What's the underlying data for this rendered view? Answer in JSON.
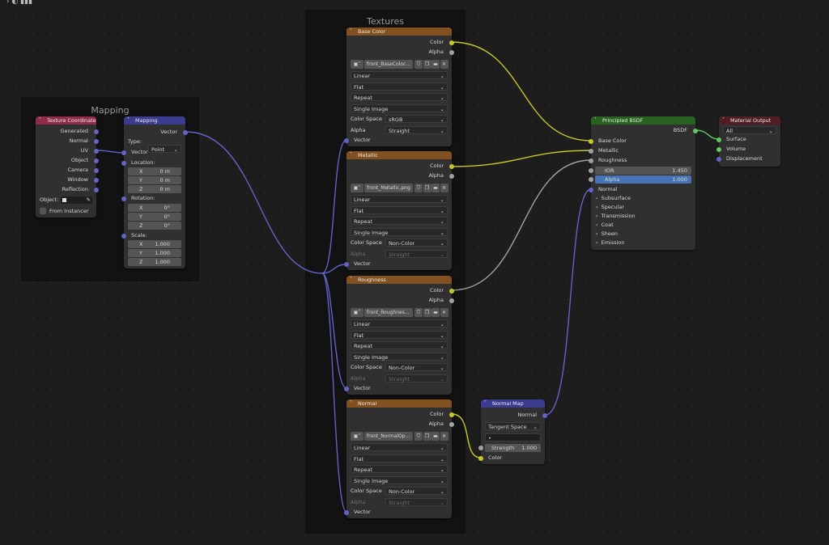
{
  "colors": {
    "texture_header": "#83501f",
    "vector_header": "#3b3b8f",
    "input_header": "#8f2c47",
    "shader_header": "#27631f",
    "output_header": "#511e26",
    "socket_color": "#c7c729",
    "socket_float": "#a1a1a1",
    "socket_vector": "#6363c7",
    "socket_shader": "#63c763"
  },
  "frames": {
    "mapping": "Mapping",
    "textures": "Textures"
  },
  "texcoord": {
    "title": "Texture Coordinate",
    "outputs": [
      "Generated",
      "Normal",
      "UV",
      "Object",
      "Camera",
      "Window",
      "Reflection"
    ],
    "object_label": "Object:",
    "from_instancer": "From Instancer"
  },
  "mapping": {
    "title": "Mapping",
    "out": "Vector",
    "type_label": "Type:",
    "type_value": "Point",
    "vector_in": "Vector",
    "location": "Location:",
    "rotation": "Rotation:",
    "scale": "Scale:",
    "loc": [
      {
        "a": "X",
        "v": "0 m"
      },
      {
        "a": "Y",
        "v": "0 m"
      },
      {
        "a": "Z",
        "v": "0 m"
      }
    ],
    "rot": [
      {
        "a": "X",
        "v": "0°"
      },
      {
        "a": "Y",
        "v": "0°"
      },
      {
        "a": "Z",
        "v": "0°"
      }
    ],
    "scl": [
      {
        "a": "X",
        "v": "1.000"
      },
      {
        "a": "Y",
        "v": "1.000"
      },
      {
        "a": "Z",
        "v": "1.000"
      }
    ]
  },
  "tex_common": {
    "out_color": "Color",
    "out_alpha": "Alpha",
    "interp": "Linear",
    "proj": "Flat",
    "ext": "Repeat",
    "source": "Single Image",
    "cs_label": "Color Space",
    "alpha_label": "Alpha",
    "alpha_value": "Straight",
    "vector_in": "Vector"
  },
  "textures": [
    {
      "title": "Base Color",
      "image": "front_BaseColor....",
      "colorspace": "sRGB"
    },
    {
      "title": "Metallic",
      "image": "front_Metallic.png",
      "colorspace": "Non-Color"
    },
    {
      "title": "Roughness",
      "image": "front_Roughnes...",
      "colorspace": "Non-Color"
    },
    {
      "title": "Normal",
      "image": "front_NormalOp...",
      "colorspace": "Non-Color"
    }
  ],
  "normalmap": {
    "title": "Normal Map",
    "out": "Normal",
    "space": "Tangent Space",
    "uv_field": "•",
    "strength_label": "Strength",
    "strength_value": "1.000",
    "color_in": "Color"
  },
  "bsdf": {
    "title": "Principled BSDF",
    "out": "BSDF",
    "base_color": "Base Color",
    "metallic": "Metallic",
    "roughness": "Roughness",
    "ior_label": "IOR",
    "ior_value": "1.450",
    "alpha_label": "Alpha",
    "alpha_value": "1.000",
    "normal": "Normal",
    "panels": [
      "Subsurface",
      "Specular",
      "Transmission",
      "Coat",
      "Sheen",
      "Emission"
    ]
  },
  "output": {
    "title": "Material Output",
    "target": "All",
    "inputs": [
      "Surface",
      "Volume",
      "Displacement"
    ]
  }
}
